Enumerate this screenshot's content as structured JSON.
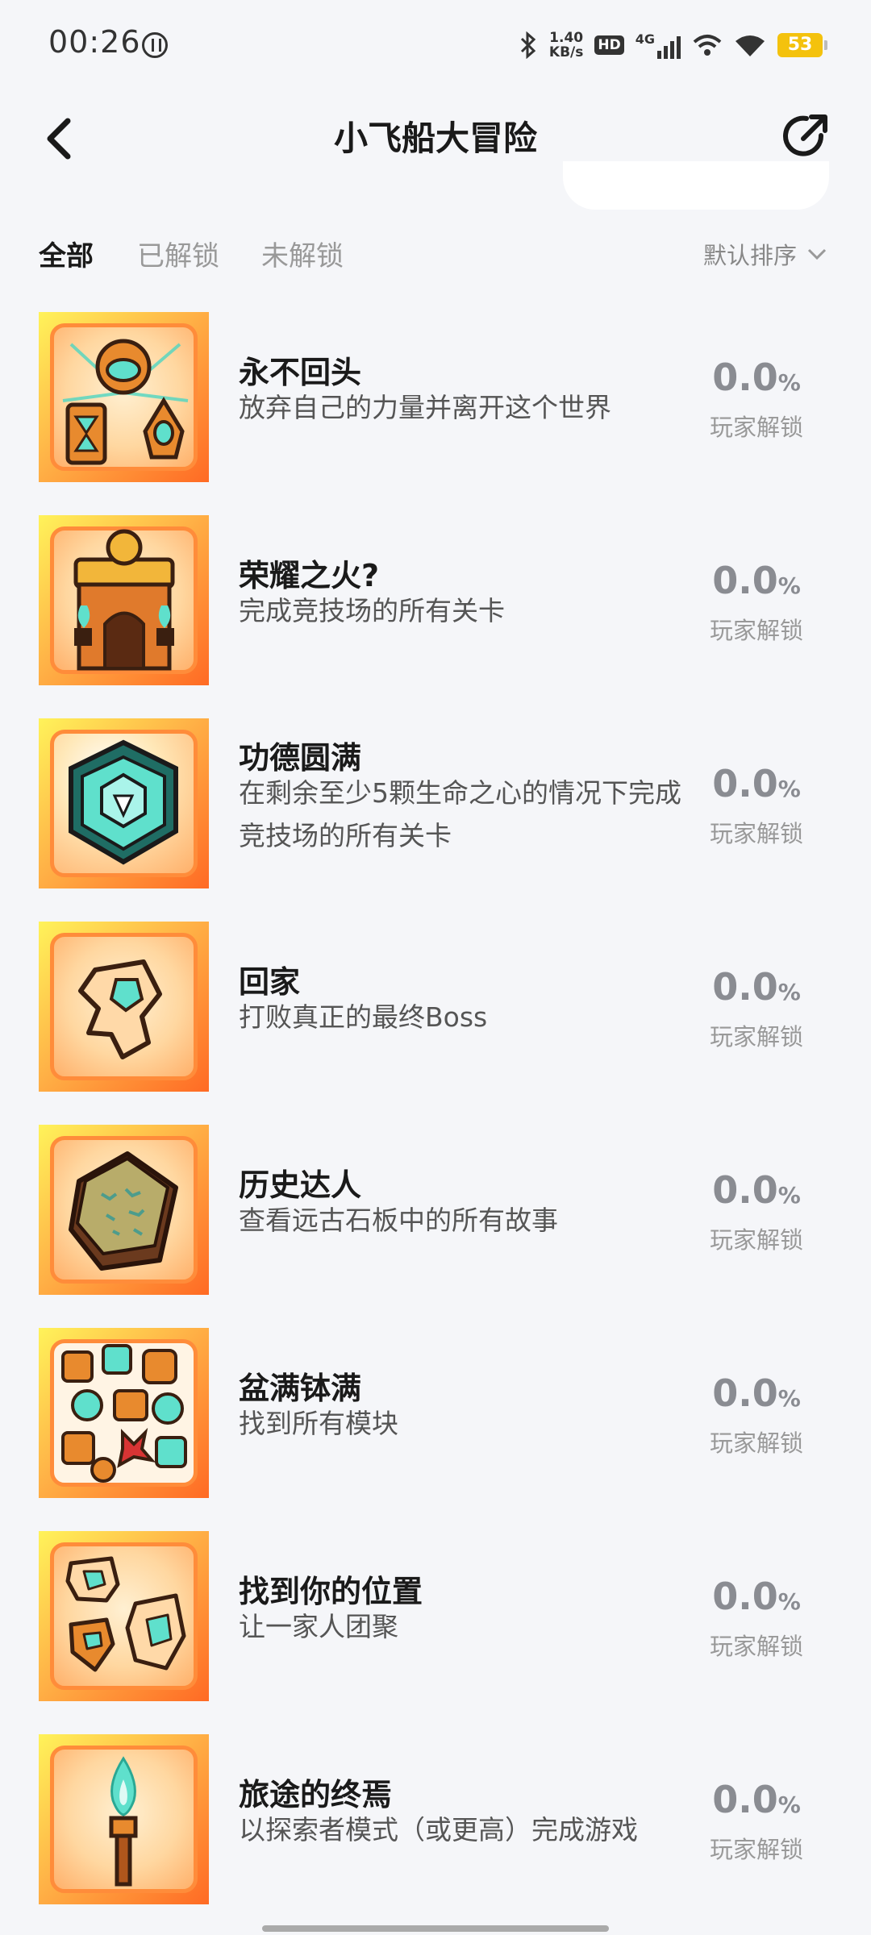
{
  "status": {
    "time": "00:26",
    "net_speed_top": "1.40",
    "net_speed_bottom": "KB/s",
    "hd": "HD",
    "signal": "4G",
    "battery": "53"
  },
  "header": {
    "title": "小飞船大冒险"
  },
  "tabs": [
    {
      "label": "全部",
      "active": true
    },
    {
      "label": "已解锁",
      "active": false
    },
    {
      "label": "未解锁",
      "active": false
    }
  ],
  "sort": {
    "label": "默认排序"
  },
  "achievements": [
    {
      "title": "永不回头",
      "desc": "放弃自己的力量并离开这个世界",
      "percent": "0.0",
      "unit": "%",
      "label": "玩家解锁",
      "icon": "robot-artifacts-icon"
    },
    {
      "title": "荣耀之火?",
      "desc": "完成竞技场的所有关卡",
      "percent": "0.0",
      "unit": "%",
      "label": "玩家解锁",
      "icon": "arena-gate-icon"
    },
    {
      "title": "功德圆满",
      "desc": "在剩余至少5颗生命之心的情况下完成竞技场的所有关卡",
      "percent": "0.0",
      "unit": "%",
      "label": "玩家解锁",
      "icon": "gem-shield-icon"
    },
    {
      "title": "回家",
      "desc": "打败真正的最终Boss",
      "percent": "0.0",
      "unit": "%",
      "label": "玩家解锁",
      "icon": "ship-home-icon"
    },
    {
      "title": "历史达人",
      "desc": "查看远古石板中的所有故事",
      "percent": "0.0",
      "unit": "%",
      "label": "玩家解锁",
      "icon": "stone-tablet-icon"
    },
    {
      "title": "盆满钵满",
      "desc": "找到所有模块",
      "percent": "0.0",
      "unit": "%",
      "label": "玩家解锁",
      "icon": "modules-pile-icon"
    },
    {
      "title": "找到你的位置",
      "desc": "让一家人团聚",
      "percent": "0.0",
      "unit": "%",
      "label": "玩家解锁",
      "icon": "family-ships-icon"
    },
    {
      "title": "旅途的终焉",
      "desc": "以探索者模式（或更高）完成游戏",
      "percent": "0.0",
      "unit": "%",
      "label": "玩家解锁",
      "icon": "torch-icon"
    }
  ]
}
